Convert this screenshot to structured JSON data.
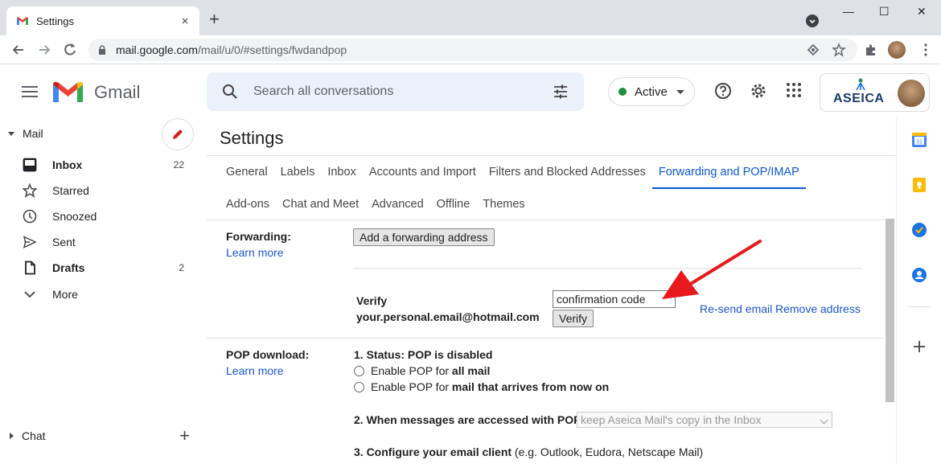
{
  "browser": {
    "tab_title": "Settings",
    "tab_close": "×",
    "new_tab": "+",
    "url_domain": "mail.google.com",
    "url_path": "/mail/u/0/#settings/fwdandpop",
    "win_min": "—",
    "win_max": "☐",
    "win_close": "✕"
  },
  "header": {
    "app_name": "Gmail",
    "search_placeholder": "Search all conversations",
    "status": "Active",
    "brand_text": "ASEICA",
    "status_color": "#1e8e3e"
  },
  "sidebar": {
    "section_label": "Mail",
    "items": [
      {
        "label": "Inbox",
        "count": "22",
        "icon": "inbox-icon",
        "bold": true
      },
      {
        "label": "Starred",
        "count": "",
        "icon": "star-icon",
        "bold": false
      },
      {
        "label": "Snoozed",
        "count": "",
        "icon": "clock-icon",
        "bold": false
      },
      {
        "label": "Sent",
        "count": "",
        "icon": "send-icon",
        "bold": false
      },
      {
        "label": "Drafts",
        "count": "2",
        "icon": "draft-icon",
        "bold": true
      },
      {
        "label": "More",
        "count": "",
        "icon": "chevron-down-icon",
        "bold": false
      }
    ],
    "chat_label": "Chat"
  },
  "settings": {
    "title": "Settings",
    "tabs_row1": [
      "General",
      "Labels",
      "Inbox",
      "Accounts and Import",
      "Filters and Blocked Addresses",
      "Forwarding and POP/IMAP"
    ],
    "tabs_row2": [
      "Add-ons",
      "Chat and Meet",
      "Advanced",
      "Offline",
      "Themes"
    ],
    "active_tab": "Forwarding and POP/IMAP",
    "forwarding": {
      "label": "Forwarding:",
      "learn_more": "Learn more",
      "add_button": "Add a forwarding address",
      "verify_label": "Verify",
      "verify_email": "your.personal.email@hotmail.com",
      "code_value": "confirmation code",
      "verify_button": "Verify",
      "resend_link": "Re-send email",
      "remove_link": "Remove address"
    },
    "pop": {
      "label": "POP download:",
      "learn_more": "Learn more",
      "status": "1. Status: POP is disabled",
      "option1_prefix": "Enable POP for ",
      "option1_bold": "all mail",
      "option2_prefix": "Enable POP for ",
      "option2_bold": "mail that arrives from now on",
      "step2": "2. When messages are accessed with POP",
      "step2_select": "keep Aseica Mail's copy in the Inbox",
      "step3": "3. Configure your email client",
      "step3_note": " (e.g. Outlook, Eudora, Netscape Mail)"
    }
  }
}
